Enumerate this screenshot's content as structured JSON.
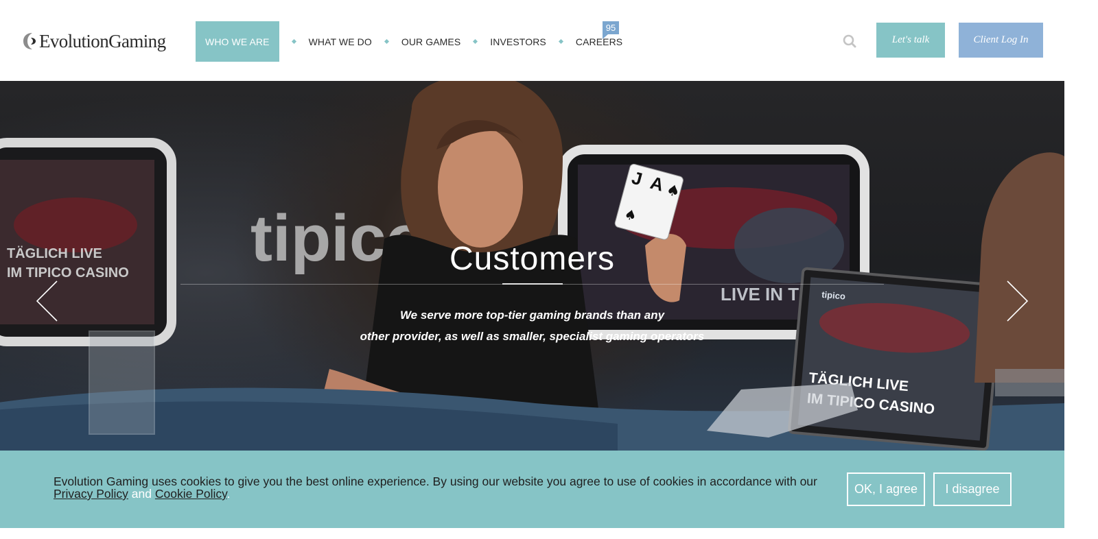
{
  "header": {
    "logo_text": "EvolutionGaming",
    "nav": [
      {
        "label": "WHO WE ARE",
        "active": true
      },
      {
        "label": "WHAT WE DO",
        "active": false
      },
      {
        "label": "OUR GAMES",
        "active": false
      },
      {
        "label": "INVESTORS",
        "active": false
      },
      {
        "label": "CAREERS",
        "active": false
      }
    ],
    "careers_badge": "95",
    "search_icon": "search-icon",
    "lets_talk_label": "Let's talk",
    "client_login_label": "Client Log In",
    "colors": {
      "accent": "#86c4c6",
      "login": "#8fb2d8",
      "badge": "#7ba6cf"
    }
  },
  "hero": {
    "title": "Customers",
    "text_line1": "We serve more top-tier gaming brands than any",
    "text_line2": "other provider, as well as smaller, specialist gaming operators",
    "prev_icon": "chevron-left-icon",
    "next_icon": "chevron-right-icon",
    "scene_text": {
      "sign": "tipico",
      "monitor_brand": "tipico",
      "monitor_line1": "TÄGLICH LIVE",
      "monitor_line2": "IM TIPICO CASINO",
      "screen_right": "LIVE IN TIPICO CASINO",
      "screen_left_line1": "TÄGLICH LIVE",
      "screen_left_line2": "IM TIPICO CASINO",
      "card_rank_1": "J",
      "card_rank_2": "A"
    }
  },
  "cookie": {
    "text": "Evolution Gaming uses cookies to give you the best online experience. By using our website you agree to use of cookies in accordance with our",
    "privacy_link": "Privacy Policy",
    "and": "and",
    "cookie_link": "Cookie Policy",
    "period": ".",
    "agree_label": "OK, I agree",
    "disagree_label": "I disagree"
  }
}
